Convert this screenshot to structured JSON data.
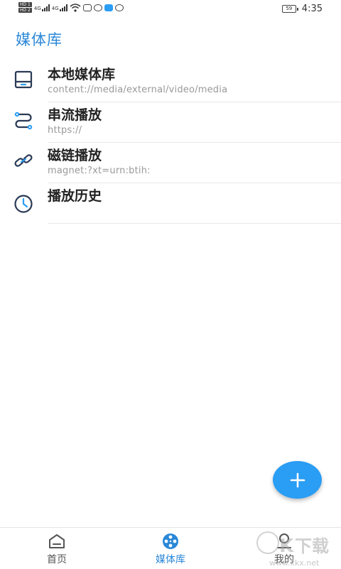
{
  "status_bar": {
    "sim_badges": [
      "HD 1",
      "HD 2"
    ],
    "network_type": "4G",
    "battery": "59",
    "time": "4:35"
  },
  "page": {
    "title": "媒体库"
  },
  "list": [
    {
      "title": "本地媒体库",
      "subtitle": "content://media/external/video/media",
      "icon": "storage-icon"
    },
    {
      "title": "串流播放",
      "subtitle": "https://",
      "icon": "stream-icon"
    },
    {
      "title": "磁链播放",
      "subtitle": "magnet:?xt=urn:btih:",
      "icon": "magnet-link-icon"
    },
    {
      "title": "播放历史",
      "subtitle": "",
      "icon": "history-icon"
    }
  ],
  "fab": {
    "icon": "plus-icon"
  },
  "bottom_nav": [
    {
      "label": "首页",
      "icon": "home-icon",
      "active": false
    },
    {
      "label": "媒体库",
      "icon": "film-reel-icon",
      "active": true
    },
    {
      "label": "我的",
      "icon": "profile-icon",
      "active": false
    }
  ],
  "watermark": {
    "text": "KK下载",
    "url_text": "www.kkx.net"
  },
  "colors": {
    "accent": "#2a87d8",
    "fab": "#2a9df4",
    "subtitle": "#999999"
  }
}
